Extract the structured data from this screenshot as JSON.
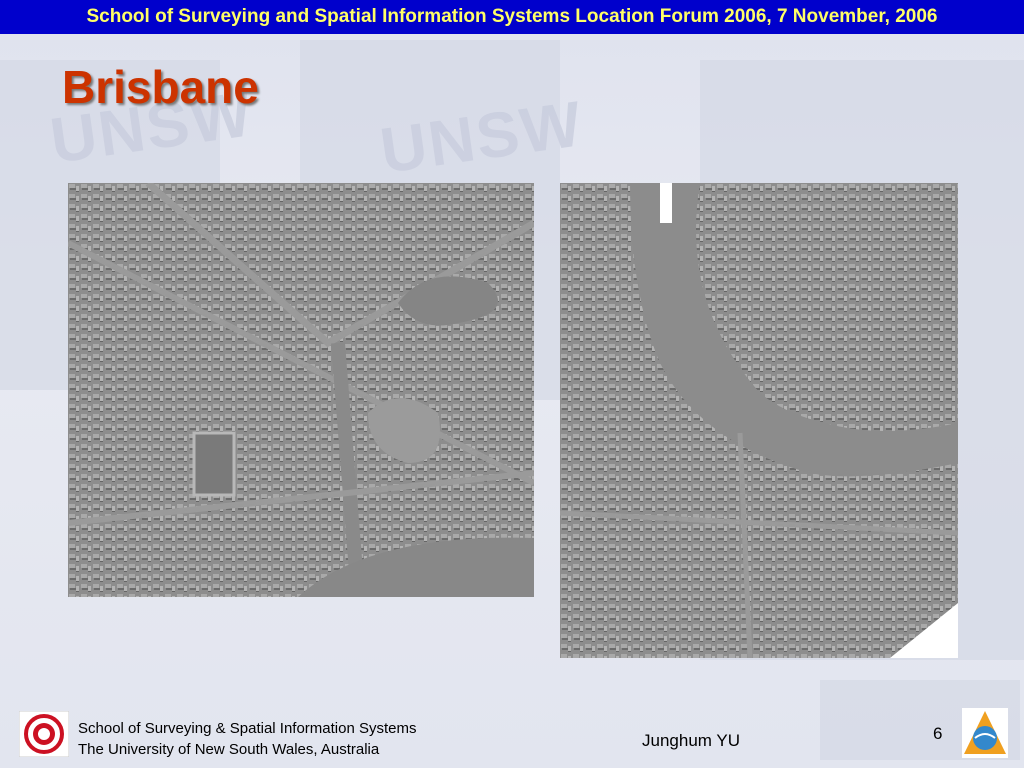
{
  "header": {
    "text": "School of Surveying and Spatial Information Systems Location Forum 2006, 7 November, 2006"
  },
  "slide": {
    "title": "Brisbane"
  },
  "maps": [
    {
      "name": "left-hillshade-map"
    },
    {
      "name": "right-hillshade-map"
    }
  ],
  "footer": {
    "institution_line1": "School of Surveying & Spatial Information Systems",
    "institution_line2": "The University of New South Wales, Australia",
    "author": "Junghum YU",
    "page_number": "6"
  },
  "logos": {
    "left": "50 YEARS SSIS UNSW",
    "right": "SSIS"
  },
  "colors": {
    "header_bg": "#0000cc",
    "header_text": "#ffff66",
    "title": "#cc3300"
  }
}
